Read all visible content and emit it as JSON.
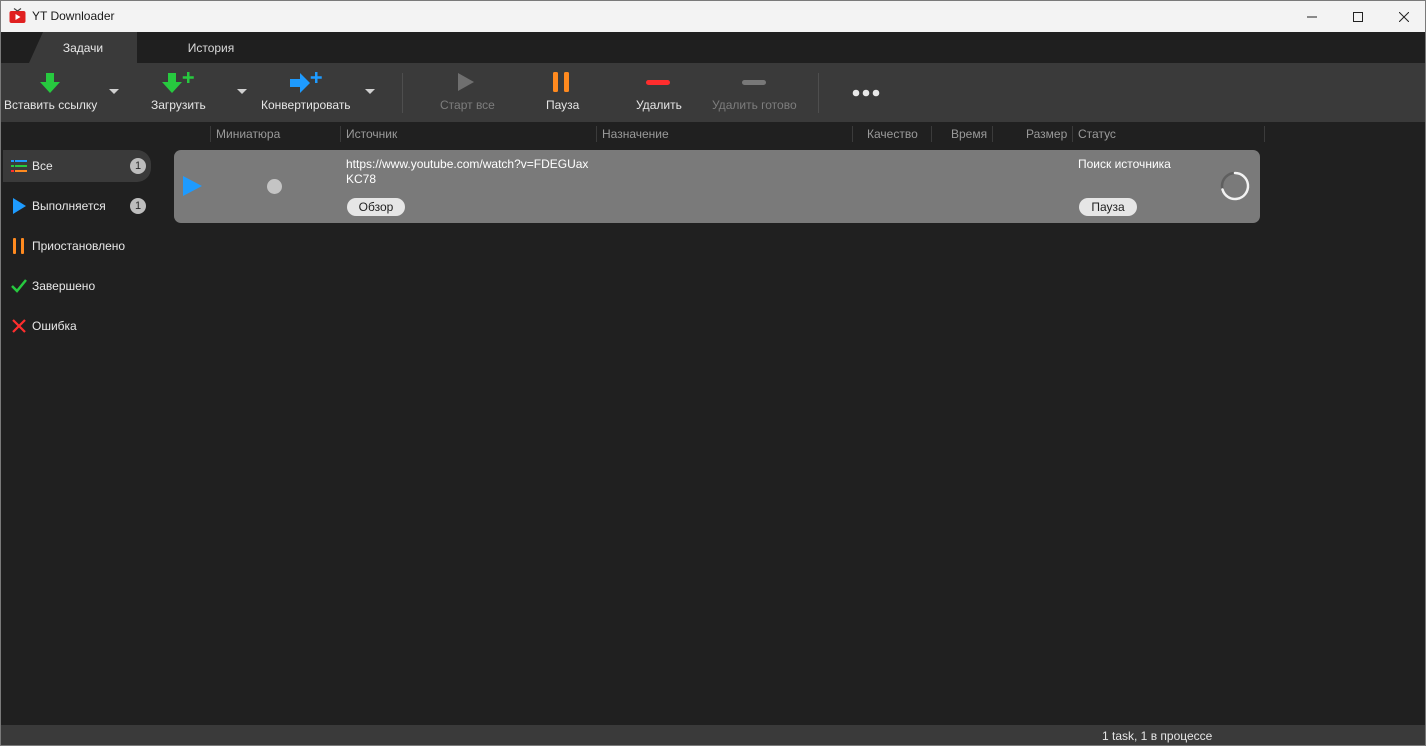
{
  "window": {
    "title": "YT Downloader"
  },
  "tabs": [
    {
      "label": "Задачи",
      "active": true
    },
    {
      "label": "История",
      "active": false
    }
  ],
  "toolbar": {
    "paste_link": "Вставить ссылку",
    "download": "Загрузить",
    "convert": "Конвертировать",
    "start_all": "Старт все",
    "pause": "Пауза",
    "delete": "Удалить",
    "delete_done": "Удалить готово",
    "more": "•••"
  },
  "columns": {
    "thumbnail": "Миниатюра",
    "source": "Источник",
    "destination": "Назначение",
    "quality": "Качество",
    "time": "Время",
    "size": "Размер",
    "status": "Статус"
  },
  "sidebar": {
    "items": [
      {
        "label": "Все",
        "count": "1",
        "icon": "list-icon",
        "active": true
      },
      {
        "label": "Выполняется",
        "count": "1",
        "icon": "play-icon",
        "active": false
      },
      {
        "label": "Приостановлено",
        "count": "",
        "icon": "pause-icon",
        "active": false
      },
      {
        "label": "Завершено",
        "count": "",
        "icon": "check-icon",
        "active": false
      },
      {
        "label": "Ошибка",
        "count": "",
        "icon": "cross-icon",
        "active": false
      }
    ]
  },
  "task": {
    "source_url": "https://www.youtube.com/watch?v=FDEGUaxKC78",
    "browse_label": "Обзор",
    "status": "Поиск источника",
    "pause_label": "Пауза"
  },
  "statusbar": {
    "summary": "1 task, 1 в процессе"
  },
  "colors": {
    "green": "#27c93f",
    "blue": "#1e9bff",
    "orange": "#ff8a1f",
    "red": "#ff2d2d",
    "toolbar_bg": "#3a3a3a",
    "row_bg": "#7a7a7a"
  }
}
